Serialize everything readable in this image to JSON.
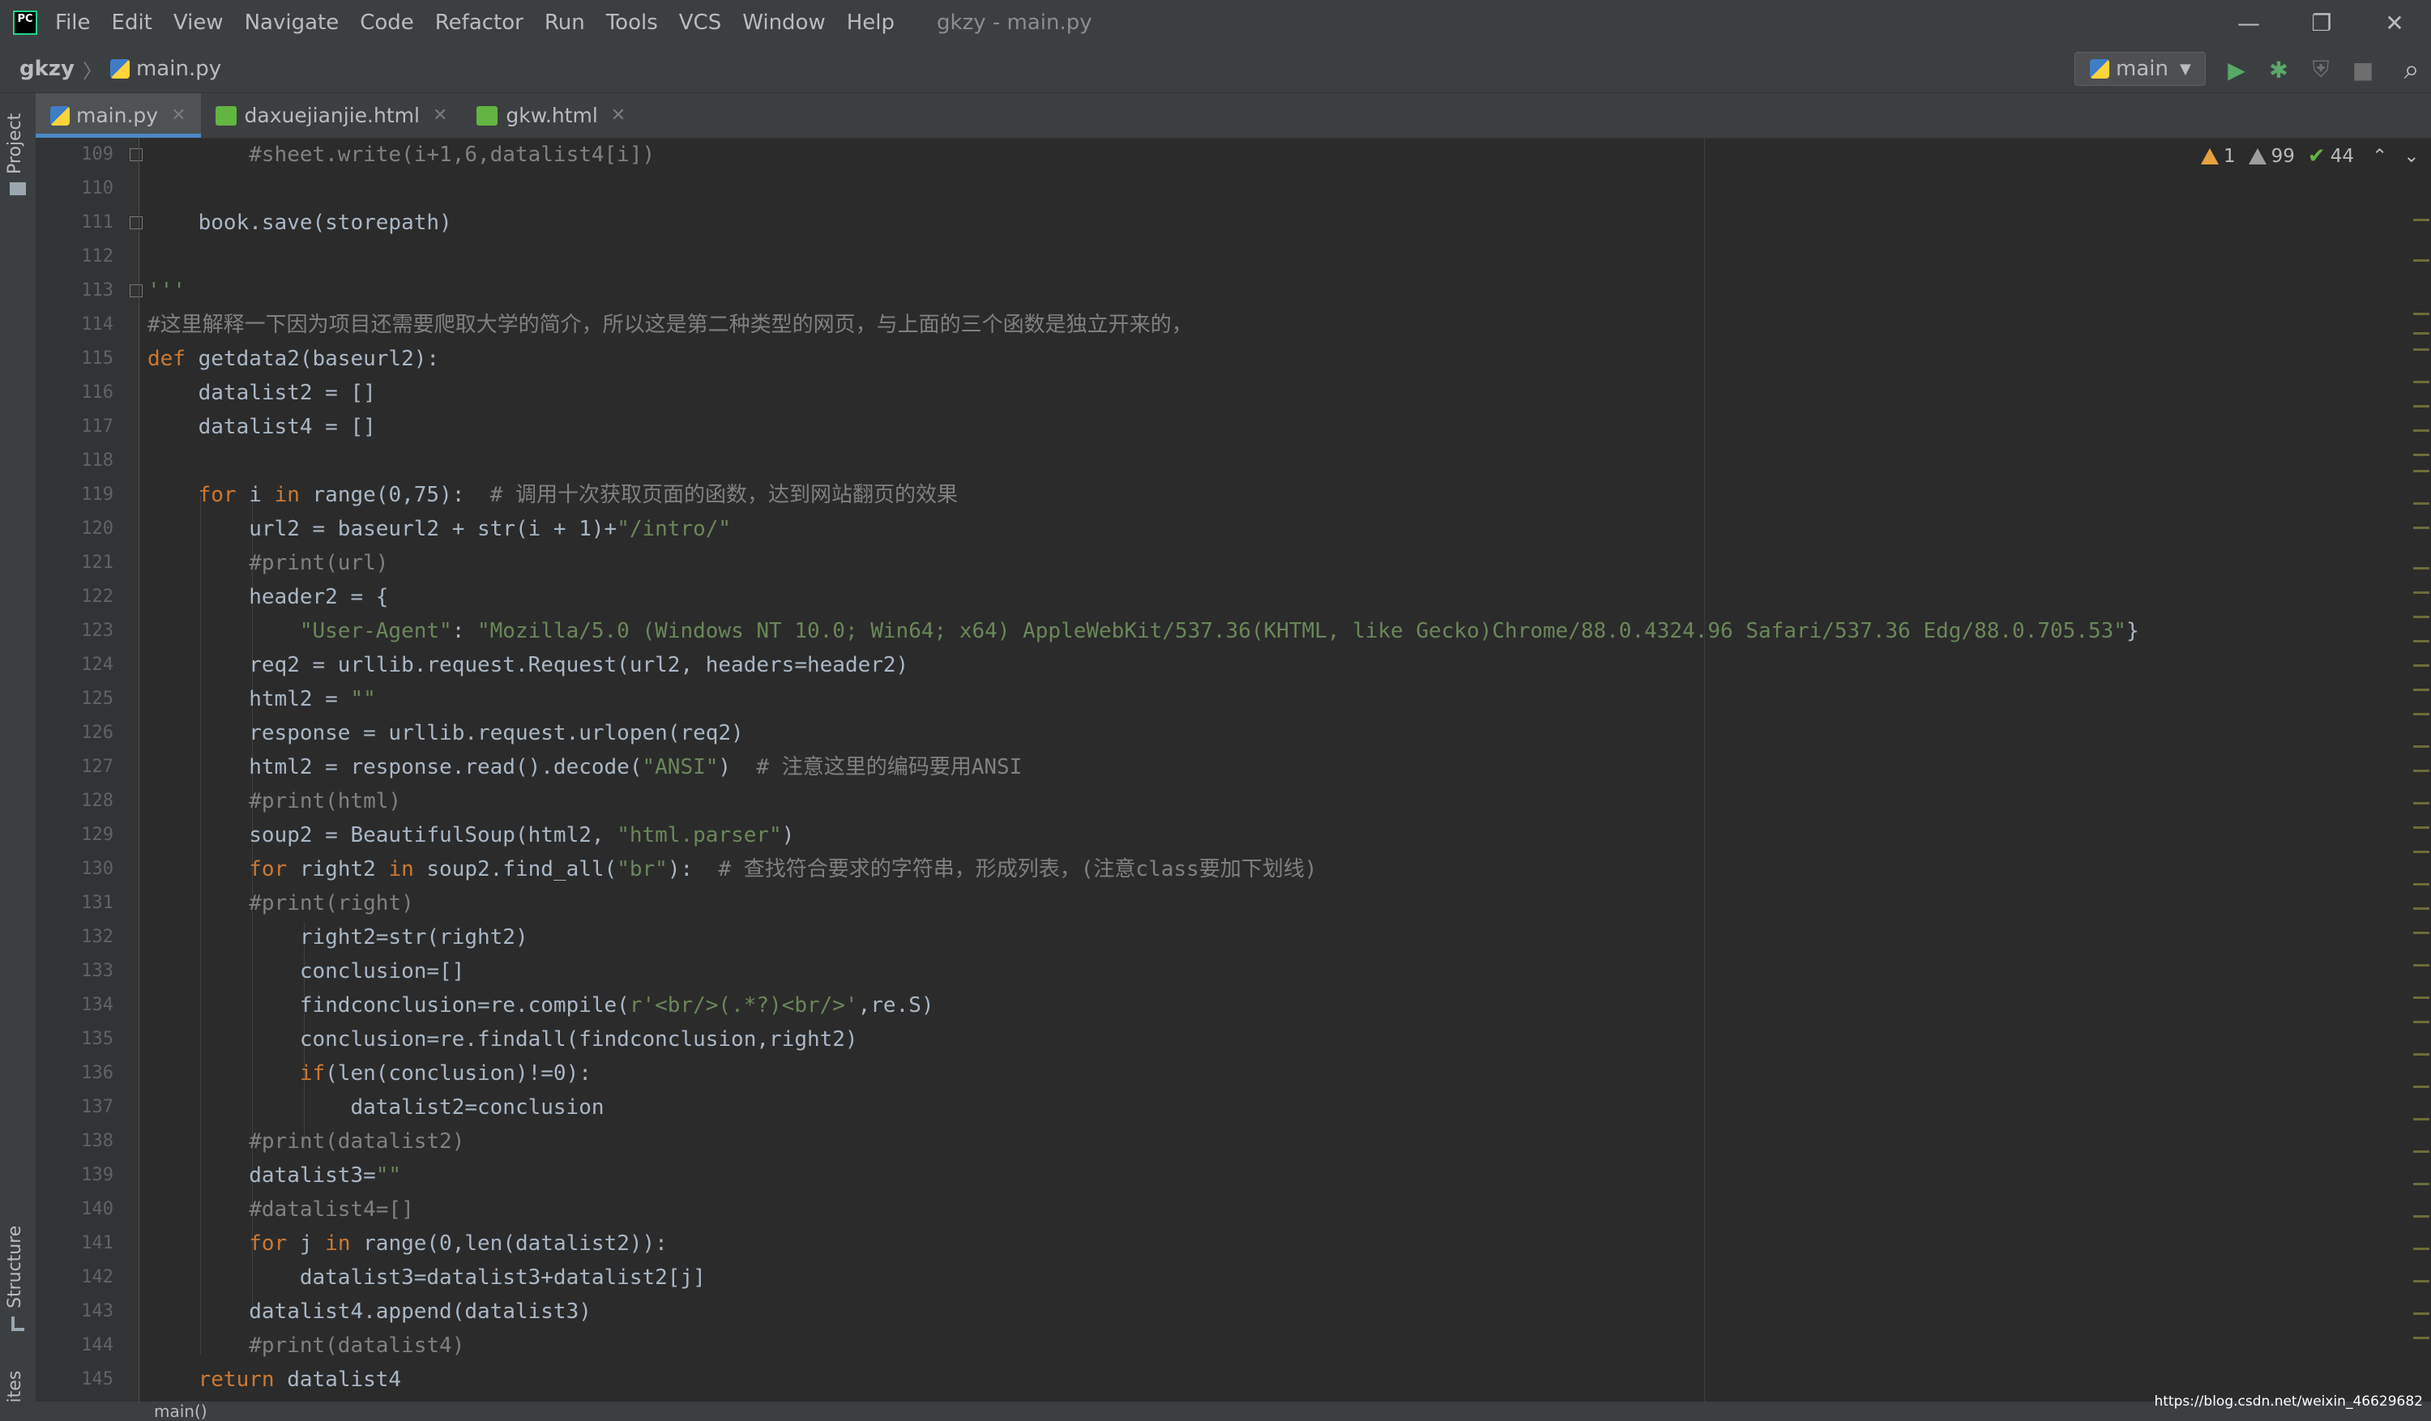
{
  "menubar": {
    "items": [
      "File",
      "Edit",
      "View",
      "Navigate",
      "Code",
      "Refactor",
      "Run",
      "Tools",
      "VCS",
      "Window",
      "Help"
    ],
    "title": "gkzy - main.py",
    "controls": [
      "—",
      "❐",
      "✕"
    ]
  },
  "breadcrumb": {
    "project": "gkzy",
    "file": "main.py"
  },
  "run_config": {
    "label": "main"
  },
  "toolbar": {
    "run": "▶",
    "debug": "✱",
    "coverage": "⛨",
    "stop": "■",
    "search": "⌕"
  },
  "tabs": [
    {
      "label": "main.py",
      "icon": "python-file-icon"
    },
    {
      "label": "daxuejianjie.html",
      "icon": "html-file-icon"
    },
    {
      "label": "gkw.html",
      "icon": "html-file-icon"
    }
  ],
  "tool_windows": {
    "project": "Project",
    "structure": "Structure",
    "favorites": "orites"
  },
  "inspections": {
    "warnings": "1",
    "weak_warnings": "99",
    "typos": "44"
  },
  "editor": {
    "line_numbers": [
      "109",
      "110",
      "111",
      "112",
      "113",
      "114",
      "115",
      "116",
      "117",
      "118",
      "119",
      "120",
      "121",
      "122",
      "123",
      "124",
      "125",
      "126",
      "127",
      "128",
      "129",
      "130",
      "131",
      "132",
      "133",
      "134",
      "135",
      "136",
      "137",
      "138",
      "139",
      "140",
      "141",
      "142",
      "143",
      "144",
      "145"
    ],
    "lines": [
      {
        "indent": "        ",
        "segs": [
          {
            "t": "#sheet.write(i+1,6,datalist4[i])",
            "c": "cmt"
          }
        ]
      },
      {
        "indent": "",
        "segs": []
      },
      {
        "indent": "    ",
        "segs": [
          {
            "t": "book.save(storepath)",
            "c": ""
          }
        ]
      },
      {
        "indent": "",
        "segs": []
      },
      {
        "indent": "",
        "segs": [
          {
            "t": "'''",
            "c": "str"
          }
        ]
      },
      {
        "indent": "",
        "segs": [
          {
            "t": "#这里解释一下因为项目还需要爬取大学的简介，所以这是第二种类型的网页，与上面的三个函数是独立开来的，",
            "c": "cmt"
          }
        ]
      },
      {
        "indent": "",
        "segs": [
          {
            "t": "def ",
            "c": "kw"
          },
          {
            "t": "getdata2(baseurl2):",
            "c": ""
          }
        ]
      },
      {
        "indent": "    ",
        "segs": [
          {
            "t": "datalist2 = []",
            "c": ""
          }
        ]
      },
      {
        "indent": "    ",
        "segs": [
          {
            "t": "datalist4 = []",
            "c": ""
          }
        ]
      },
      {
        "indent": "",
        "segs": []
      },
      {
        "indent": "    ",
        "segs": [
          {
            "t": "for ",
            "c": "kw"
          },
          {
            "t": "i ",
            "c": ""
          },
          {
            "t": "in ",
            "c": "kw"
          },
          {
            "t": "range(0,75):  ",
            "c": ""
          },
          {
            "t": "# 调用十次获取页面的函数，达到网站翻页的效果",
            "c": "cmt"
          }
        ]
      },
      {
        "indent": "        ",
        "segs": [
          {
            "t": "url2 = baseurl2 + str(i + 1)+",
            "c": ""
          },
          {
            "t": "\"/intro/\"",
            "c": "str"
          }
        ]
      },
      {
        "indent": "        ",
        "segs": [
          {
            "t": "#print(url)",
            "c": "cmt"
          }
        ]
      },
      {
        "indent": "        ",
        "segs": [
          {
            "t": "header2 = {",
            "c": ""
          }
        ]
      },
      {
        "indent": "            ",
        "segs": [
          {
            "t": "\"User-Agent\"",
            "c": "str"
          },
          {
            "t": ": ",
            "c": ""
          },
          {
            "t": "\"Mozilla/5.0 (Windows NT 10.0; Win64; x64) AppleWebKit/537.36(KHTML, like Gecko)Chrome/88.0.4324.96 Safari/537.36 Edg/88.0.705.53\"",
            "c": "str"
          },
          {
            "t": "}",
            "c": ""
          }
        ]
      },
      {
        "indent": "        ",
        "segs": [
          {
            "t": "req2 = urllib.request.Request(url2, headers=header2)",
            "c": ""
          }
        ]
      },
      {
        "indent": "        ",
        "segs": [
          {
            "t": "html2 = ",
            "c": ""
          },
          {
            "t": "\"\"",
            "c": "str"
          }
        ]
      },
      {
        "indent": "        ",
        "segs": [
          {
            "t": "response = urllib.request.urlopen(req2)",
            "c": ""
          }
        ]
      },
      {
        "indent": "        ",
        "segs": [
          {
            "t": "html2 = response.read().decode(",
            "c": ""
          },
          {
            "t": "\"ANSI\"",
            "c": "str"
          },
          {
            "t": ")  ",
            "c": ""
          },
          {
            "t": "# 注意这里的编码要用ANSI",
            "c": "cmt"
          }
        ]
      },
      {
        "indent": "        ",
        "segs": [
          {
            "t": "#print(html)",
            "c": "cmt"
          }
        ]
      },
      {
        "indent": "        ",
        "segs": [
          {
            "t": "soup2 = BeautifulSoup(html2, ",
            "c": ""
          },
          {
            "t": "\"html.parser\"",
            "c": "str"
          },
          {
            "t": ")",
            "c": ""
          }
        ]
      },
      {
        "indent": "        ",
        "segs": [
          {
            "t": "for ",
            "c": "kw"
          },
          {
            "t": "right2 ",
            "c": ""
          },
          {
            "t": "in ",
            "c": "kw"
          },
          {
            "t": "soup2.find_all(",
            "c": ""
          },
          {
            "t": "\"br\"",
            "c": "str"
          },
          {
            "t": "):  ",
            "c": ""
          },
          {
            "t": "# 查找符合要求的字符串，形成列表，(注意class要加下划线)",
            "c": "cmt"
          }
        ]
      },
      {
        "indent": "        ",
        "segs": [
          {
            "t": "#print(right)",
            "c": "cmt"
          }
        ]
      },
      {
        "indent": "            ",
        "segs": [
          {
            "t": "right2=str(right2)",
            "c": ""
          }
        ]
      },
      {
        "indent": "            ",
        "segs": [
          {
            "t": "conclusion=[]",
            "c": ""
          }
        ]
      },
      {
        "indent": "            ",
        "segs": [
          {
            "t": "findconclusion=re.compile(",
            "c": ""
          },
          {
            "t": "r'<br/>(.*?)<br/>'",
            "c": "str"
          },
          {
            "t": ",re.S)",
            "c": ""
          }
        ]
      },
      {
        "indent": "            ",
        "segs": [
          {
            "t": "conclusion=re.findall(findconclusion,right2)",
            "c": ""
          }
        ]
      },
      {
        "indent": "            ",
        "segs": [
          {
            "t": "if",
            "c": "kw"
          },
          {
            "t": "(len(conclusion)!=0):",
            "c": ""
          }
        ]
      },
      {
        "indent": "                ",
        "segs": [
          {
            "t": "datalist2=conclusion",
            "c": ""
          }
        ]
      },
      {
        "indent": "        ",
        "segs": [
          {
            "t": "#print(datalist2)",
            "c": "cmt"
          }
        ]
      },
      {
        "indent": "        ",
        "segs": [
          {
            "t": "datalist3=",
            "c": ""
          },
          {
            "t": "\"\"",
            "c": "str"
          }
        ]
      },
      {
        "indent": "        ",
        "segs": [
          {
            "t": "#datalist4=[]",
            "c": "cmt"
          }
        ]
      },
      {
        "indent": "        ",
        "segs": [
          {
            "t": "for ",
            "c": "kw"
          },
          {
            "t": "j ",
            "c": ""
          },
          {
            "t": "in ",
            "c": "kw"
          },
          {
            "t": "range(0,len(datalist2)):",
            "c": ""
          }
        ]
      },
      {
        "indent": "            ",
        "segs": [
          {
            "t": "datalist3=datalist3+datalist2[j]",
            "c": ""
          }
        ]
      },
      {
        "indent": "        ",
        "segs": [
          {
            "t": "datalist4.append(datalist3)",
            "c": ""
          }
        ]
      },
      {
        "indent": "        ",
        "segs": [
          {
            "t": "#print(datalist4)",
            "c": "cmt"
          }
        ]
      },
      {
        "indent": "    ",
        "segs": [
          {
            "t": "return ",
            "c": "kw"
          },
          {
            "t": "datalist4",
            "c": ""
          }
        ]
      }
    ]
  },
  "status": {
    "breadcrumb": "main()"
  },
  "watermark": "https://blog.csdn.net/weixin_46629682",
  "colors": {
    "background": "#2b2b2b",
    "keyword": "#cc7832",
    "string": "#6a8759",
    "comment": "#808080",
    "accent": "#4a88c7"
  }
}
